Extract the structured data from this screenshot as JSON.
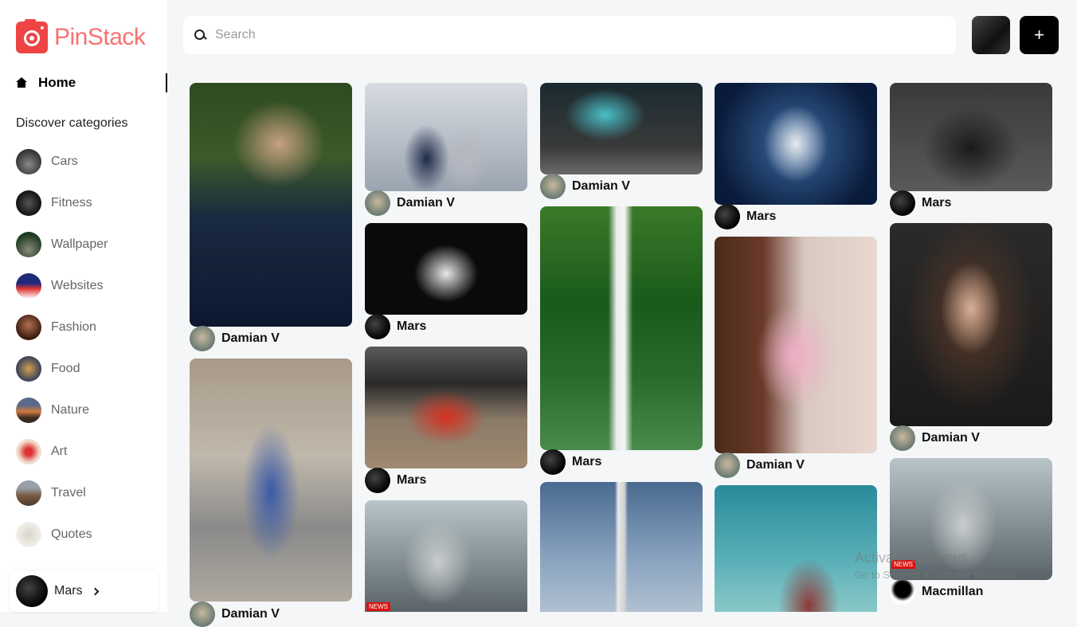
{
  "app": {
    "name": "PinStack"
  },
  "nav": {
    "home_label": "Home"
  },
  "sidebar": {
    "discover_heading": "Discover categories",
    "categories": [
      {
        "label": "Cars",
        "color": "#4a4a4a"
      },
      {
        "label": "Fitness",
        "color": "#2b2b2b"
      },
      {
        "label": "Wallpaper",
        "color": "#3d5a3d"
      },
      {
        "label": "Websites",
        "color": "#2a3a8c"
      },
      {
        "label": "Fashion",
        "color": "#5a3020"
      },
      {
        "label": "Food",
        "color": "#8a6a3a"
      },
      {
        "label": "Nature",
        "color": "#b06a3a"
      },
      {
        "label": "Art",
        "color": "#e0b0a0"
      },
      {
        "label": "Travel",
        "color": "#7a6a5a"
      },
      {
        "label": "Quotes",
        "color": "#e8e6df"
      }
    ],
    "user": {
      "name": "Mars"
    }
  },
  "search": {
    "placeholder": "Search"
  },
  "toolbar": {
    "add_label": "+"
  },
  "pins": [
    {
      "author": "Damian V",
      "theme": "man-in-suit"
    },
    {
      "author": "Damian V",
      "theme": "woman-fashion"
    },
    {
      "author": "Damian V",
      "theme": "business-people"
    },
    {
      "author": "Mars",
      "theme": "asimo-robot"
    },
    {
      "author": "Mars",
      "theme": "red-sports-car"
    },
    {
      "author": "",
      "theme": "humanoid-robot"
    },
    {
      "author": "Damian V",
      "theme": "laptop-hologram"
    },
    {
      "author": "Mars",
      "theme": "waterfall"
    },
    {
      "author": "",
      "theme": "rocket"
    },
    {
      "author": "Mars",
      "theme": "white-robot"
    },
    {
      "author": "Damian V",
      "theme": "man-pink-shirt"
    },
    {
      "author": "",
      "theme": "castle"
    },
    {
      "author": "Mars",
      "theme": "two-men"
    },
    {
      "author": "Damian V",
      "theme": "woman-glasses"
    },
    {
      "author": "Macmillan",
      "theme": "humanoid-robot"
    }
  ],
  "partial_author": "Damian V",
  "watermark": {
    "line1": "Activate Windows",
    "line2": "Go to Settings to activate Windows."
  },
  "badges": {
    "news": "NEWS"
  }
}
